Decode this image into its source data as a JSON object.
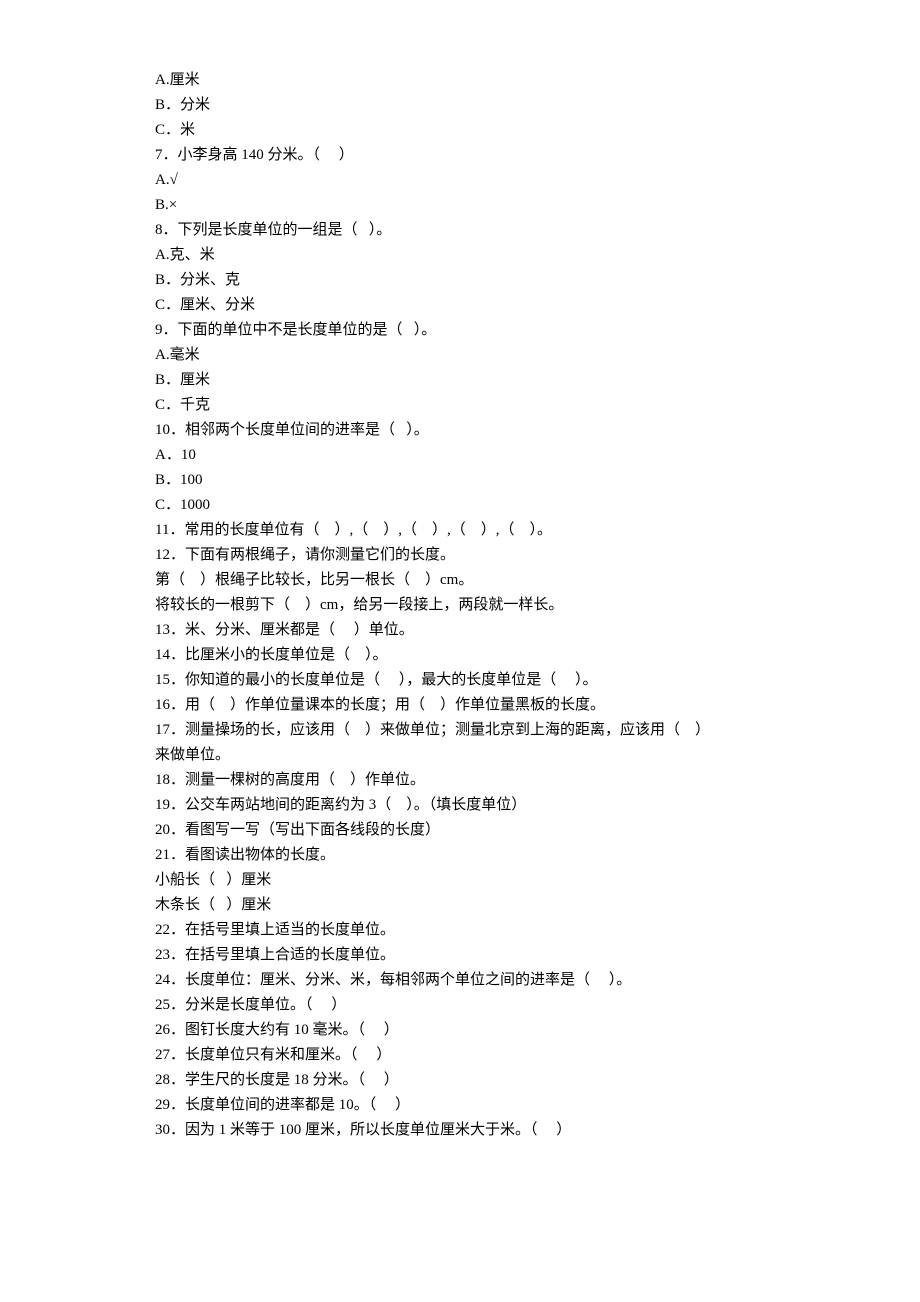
{
  "lines": [
    "A.厘米",
    "B．分米",
    "C．米",
    "7．小李身高 140 分米。（     ）",
    "A.√",
    "B.×",
    "8．下列是长度单位的一组是（   ）。",
    "A.克、米",
    "B．分米、克",
    "C．厘米、分米",
    "9．下面的单位中不是长度单位的是（   ）。",
    "A.毫米",
    "B．厘米",
    "C．千克",
    "10．相邻两个长度单位间的进率是（   ）。",
    "A．10",
    "B．100",
    "C．1000",
    "11．常用的长度单位有（    ）,（    ）,（    ）,（    ）,（    ）。",
    "12．下面有两根绳子，请你测量它们的长度。",
    "第（    ）根绳子比较长，比另一根长（    ）cm。",
    "将较长的一根剪下（    ）cm，给另一段接上，两段就一样长。",
    "13．米、分米、厘米都是（     ）单位。",
    "14．比厘米小的长度单位是（    ）。",
    "15．你知道的最小的长度单位是（     ），最大的长度单位是（     ）。",
    "16．用（    ）作单位量课本的长度；用（    ）作单位量黑板的长度。",
    "17．测量操场的长，应该用（    ）来做单位；测量北京到上海的距离，应该用（    ）",
    "来做单位。",
    "18．测量一棵树的高度用（    ）作单位。",
    "19．公交车两站地间的距离约为 3（    ）。（填长度单位）",
    "20．看图写一写（写出下面各线段的长度）",
    "21．看图读出物体的长度。",
    "小船长（   ）厘米",
    "木条长（   ）厘米",
    "22．在括号里填上适当的长度单位。",
    "23．在括号里填上合适的长度单位。",
    "24．长度单位：厘米、分米、米，每相邻两个单位之间的进率是（     ）。",
    "25．分米是长度单位。（     ）",
    "26．图钉长度大约有 10 毫米。（     ）",
    "27．长度单位只有米和厘米。（     ）",
    "28．学生尺的长度是 18 分米。（     ）",
    "29．长度单位间的进率都是 10。（     ）",
    "30．因为 1 米等于 100 厘米，所以长度单位厘米大于米。（     ）"
  ]
}
